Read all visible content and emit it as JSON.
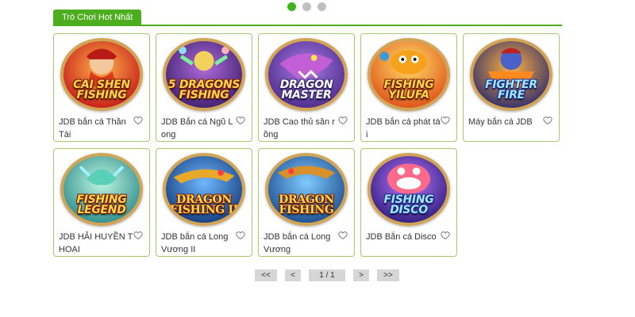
{
  "carousel": {
    "dots": 3,
    "active": 0
  },
  "section": {
    "title": "Trò Chơi Hot Nhất"
  },
  "colors": {
    "accent": "#4cae1f",
    "card_border": "#a7c96d",
    "ring": "#d2a455"
  },
  "games": [
    {
      "title": "JDB bắn cá Thần Tài",
      "logo": "CAI SHEN FISHING",
      "icon": "heart-icon"
    },
    {
      "title": "JDB Bắn cá Ngũ Long",
      "logo": "5 DRAGONS FISHING",
      "icon": "heart-icon"
    },
    {
      "title": "JDB Cao thủ săn rồng",
      "logo": "DRAGON MASTER",
      "icon": "heart-icon"
    },
    {
      "title": "JDB bắn cá phát tài",
      "logo": "FISHING YILUFA",
      "icon": "heart-icon"
    },
    {
      "title": "Máy bắn cá JDB",
      "logo": "FIGHTER FIRE",
      "icon": "heart-icon"
    },
    {
      "title": "JDB HẢI HUYỀN THOẠI",
      "logo": "FISHING LEGEND",
      "icon": "heart-icon"
    },
    {
      "title": "JDB bắn cá Long Vương II",
      "logo": "DRAGON FISHING II",
      "icon": "heart-icon"
    },
    {
      "title": "JDB bắn cá Long Vương",
      "logo": "DRAGON FISHING",
      "icon": "heart-icon"
    },
    {
      "title": "JDB Bắn cá Disco",
      "logo": "FISHING DISCO",
      "icon": "heart-icon"
    }
  ],
  "pagination": {
    "first": "<<",
    "prev": "<",
    "current": "1 / 1",
    "next": ">",
    "last": ">>"
  }
}
